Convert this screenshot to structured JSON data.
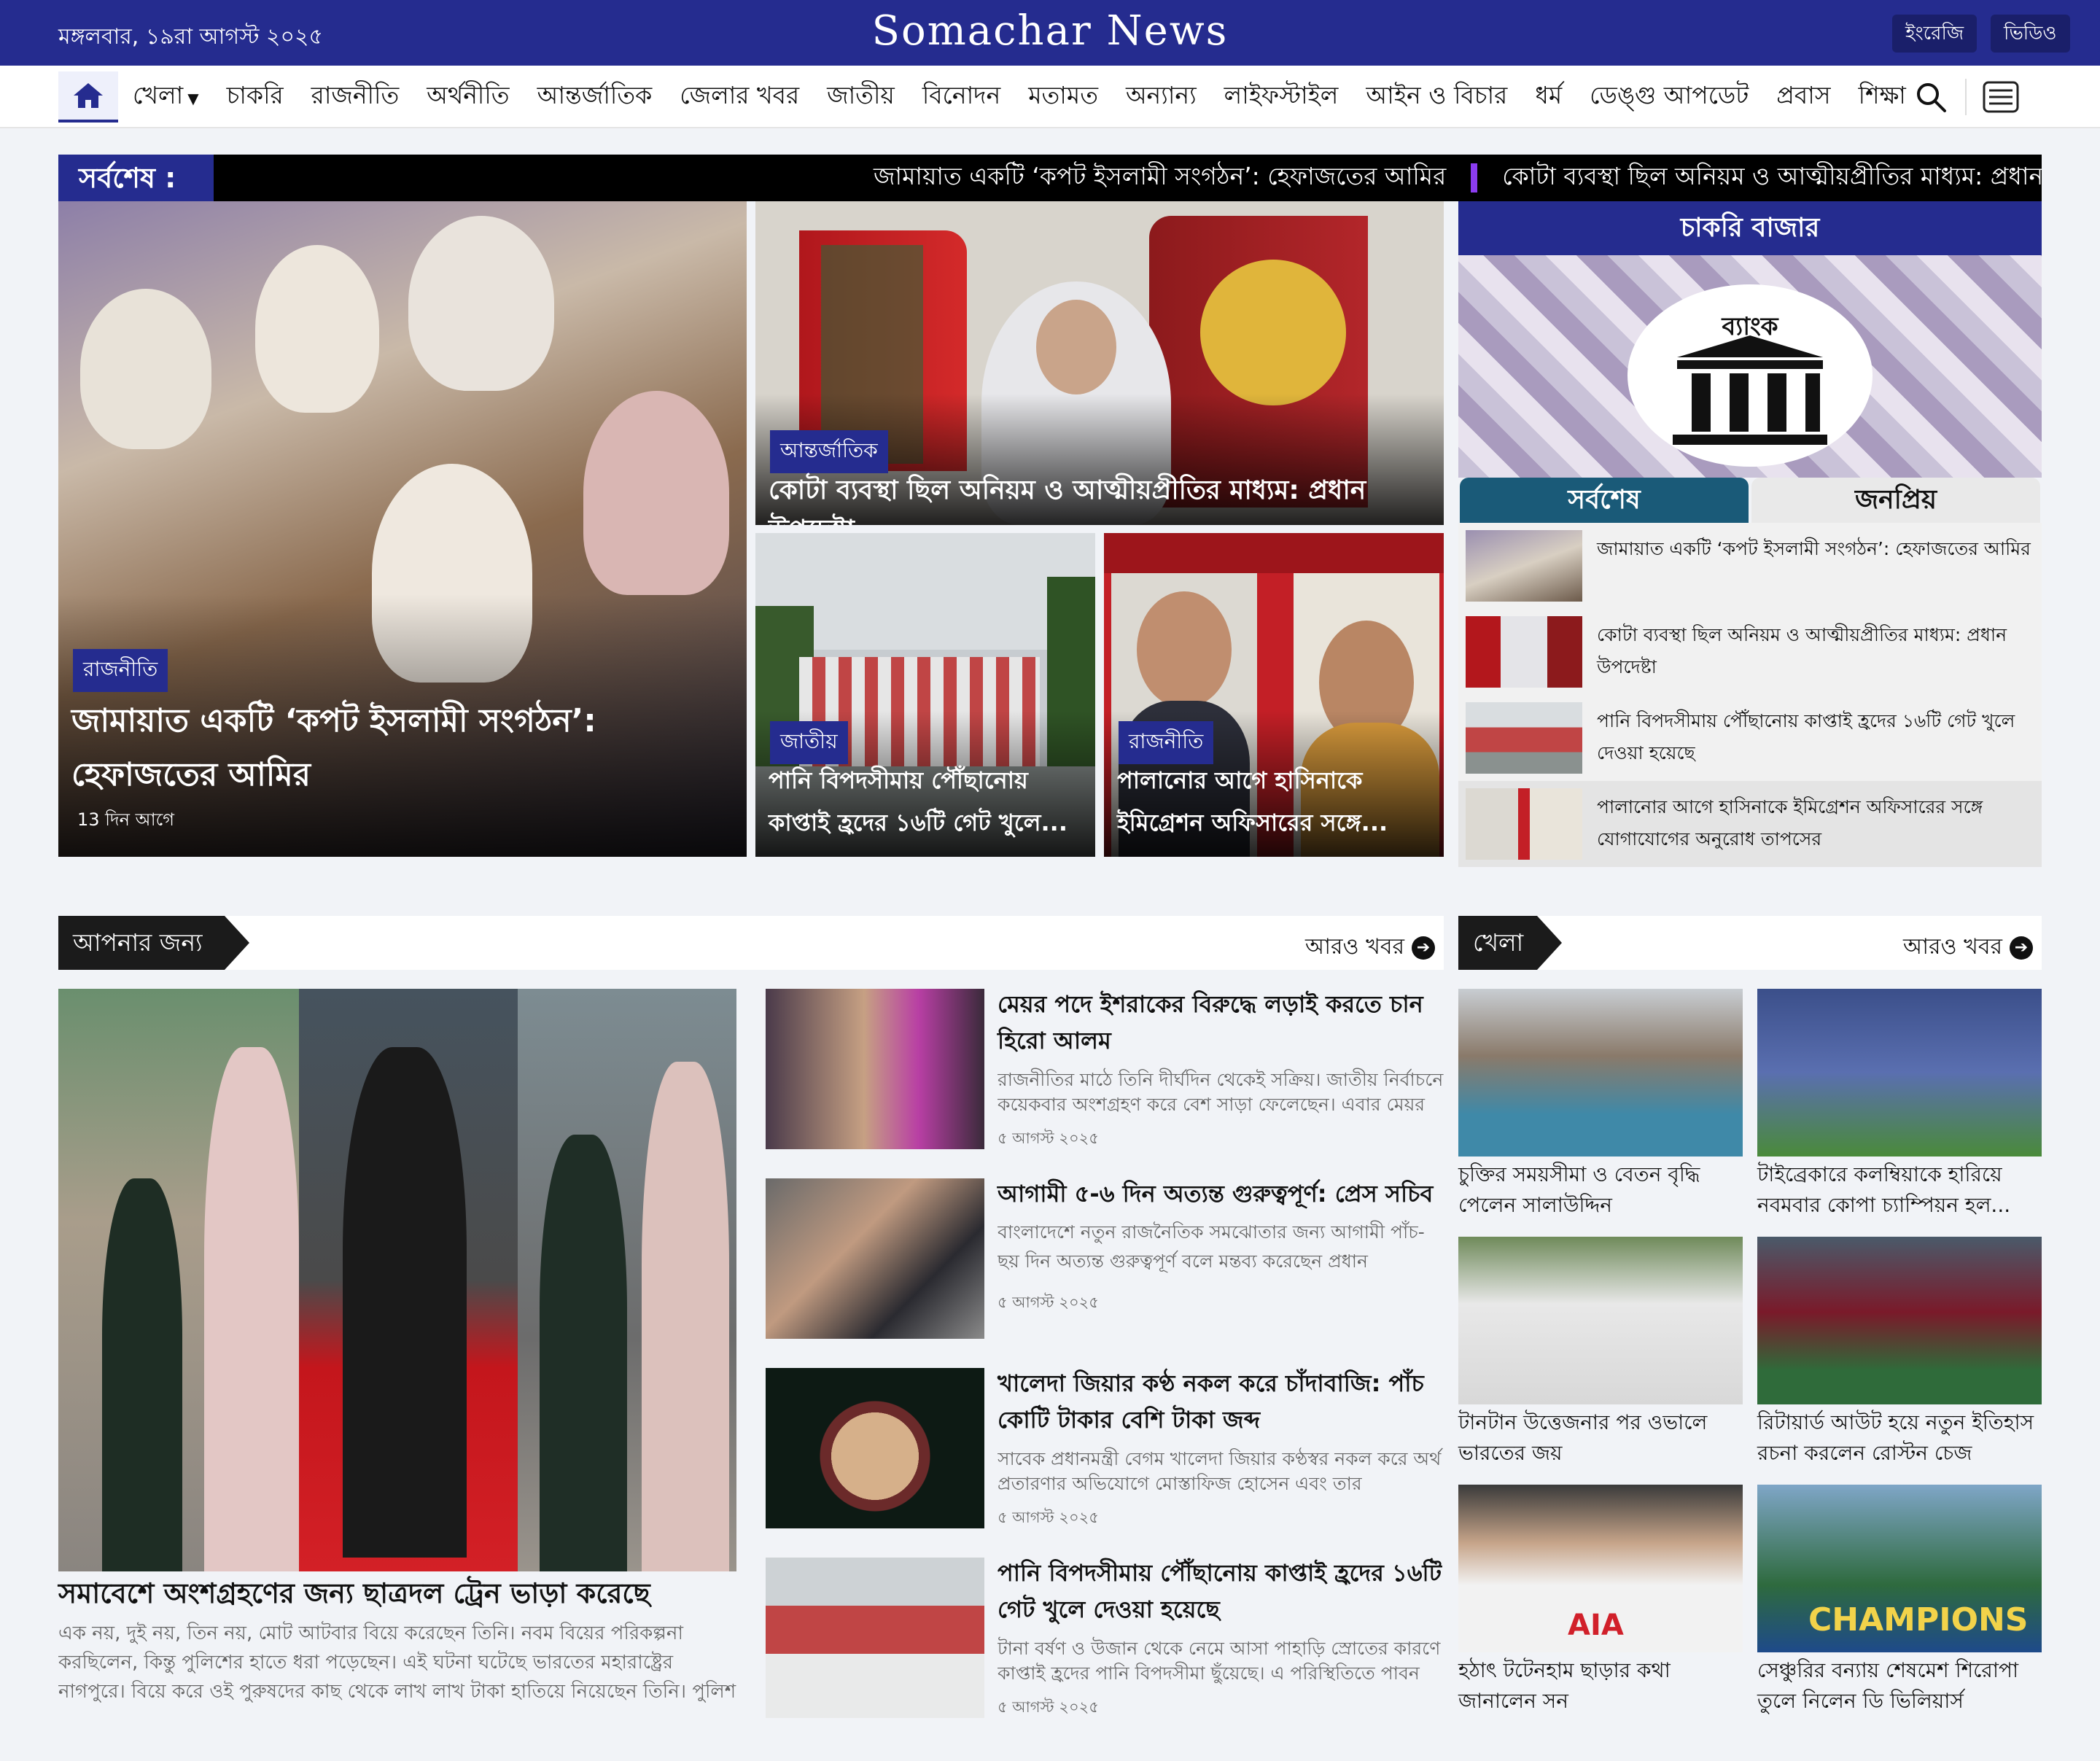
{
  "header": {
    "date": "মঙ্গলবার, ১৯রা আগস্ট ২০২৫",
    "brand": "Somachar News",
    "btn_english": "ইংরেজি",
    "btn_video": "ভিডিও"
  },
  "nav": {
    "items": [
      "খেলা",
      "চাকরি",
      "রাজনীতি",
      "অর্থনীতি",
      "আন্তর্জাতিক",
      "জেলার খবর",
      "জাতীয়",
      "বিনোদন",
      "মতামত",
      "অন্যান্য",
      "লাইফস্টাইল",
      "আইন ও বিচার",
      "ধর্ম",
      "ডেঙ্গু আপডেট",
      "প্রবাস",
      "শিক্ষা"
    ]
  },
  "ticker": {
    "label": "সর্বশেষ :",
    "items": [
      "জামায়াত একটি ‘কপট ইসলামী সংগঠন’: হেফাজতের আমির",
      "কোটা ব্যবস্থা ছিল অনিয়ম ও আত্মীয়প্রীতির মাধ্যম: প্রধান উপদেষ্টা"
    ]
  },
  "hero": {
    "main": {
      "category": "রাজনীতি",
      "title": "জামায়াত একটি ‘কপট ইসলামী সংগঠন’: হেফাজতের আমির",
      "time": "13 দিন আগে"
    },
    "top_right": {
      "category": "আন্তর্জাতিক",
      "title": "কোটা ব্যবস্থা ছিল অনিয়ম ও আত্মীয়প্রীতির মাধ্যম: প্রধান উপদেষ্টা"
    },
    "bottom_left": {
      "category": "জাতীয়",
      "title": "পানি বিপদসীমায় পৌঁছানোয় কাপ্তাই হ্রদের ১৬টি গেট খুলে..."
    },
    "bottom_right": {
      "category": "রাজনীতি",
      "title": "পালানোর আগে হাসিনাকে ইমিগ্রেশন অফিসারের সঙ্গে..."
    }
  },
  "sidebar": {
    "job_title": "চাকরি বাজার",
    "bank_label": "ব্যাংক",
    "tab_latest": "সর্বশেষ",
    "tab_popular": "জনপ্রিয়",
    "latest": [
      "জামায়াত একটি ‘কপট ইসলামী সংগঠন’: হেফাজতের আমির",
      "কোটা ব্যবস্থা ছিল অনিয়ম ও আত্মীয়প্রীতির মাধ্যম: প্রধান উপদেষ্টা",
      "পানি বিপদসীমায় পৌঁছানোয় কাপ্তাই হ্রদের ১৬টি গেট খুলে দেওয়া হয়েছে",
      "পালানোর আগে হাসিনাকে ইমিগ্রেশন অফিসারের সঙ্গে যোগাযোগের অনুরোধ তাপসের"
    ]
  },
  "for_you": {
    "title": "আপনার জন্য",
    "more": "আরও খবর",
    "lead": {
      "title": "সমাবেশে অংশগ্রহণের জন্য ছাত্রদল ট্রেন ভাড়া করেছে",
      "desc": "এক নয়, দুই নয়, তিন নয়, মোট আটবার বিয়ে করেছেন তিনি। নবম বিয়ের পরিকল্পনা করছিলেন, কিন্তু পুলিশের হাতে ধরা পড়েছেন। এই ঘটনা ঘটেছে ভারতের মহারাষ্ট্রের নাগপুরে। বিয়ে করে ওই পুরুষদের কাছ থেকে লাখ লাখ টাকা হাতিয়ে নিয়েছেন তিনি। পুলিশ জানিয়েছে..."
    },
    "stories": [
      {
        "title": "মেয়র পদে ইশরাকের বিরুদ্ধে লড়াই করতে চান হিরো আলম",
        "desc": "রাজনীতির মাঠে তিনি দীর্ঘদিন থেকেই সক্রিয়। জাতীয় নির্বাচনে কয়েকবার অংশগ্রহণ করে বেশ সাড়া ফেলেছেন। এবার মেয়র",
        "date": "৫ আগস্ট ২০২৫"
      },
      {
        "title": "আগামী ৫-৬ দিন অত্যন্ত গুরুত্বপূর্ণ: প্রেস সচিব",
        "desc": "বাংলাদেশে নতুন রাজনৈতিক সমঝোতার জন্য আগামী পাঁচ-ছয় দিন অত্যন্ত গুরুত্বপূর্ণ বলে মন্তব্য করেছেন প্রধান উপদেষ্টার...",
        "date": "৫ আগস্ট ২০২৫"
      },
      {
        "title": "খালেদা জিয়ার কণ্ঠ নকল করে চাঁদাবাজি: পাঁচ কোটি টাকার বেশি টাকা জব্দ",
        "desc": "সাবেক প্রধানমন্ত্রী বেগম খালেদা জিয়ার কণ্ঠস্বর নকল করে অর্থ প্রতারণার অভিযোগে মোস্তাফিজ হোসেন এবং তার",
        "date": "৫ আগস্ট ২০২৫"
      },
      {
        "title": "পানি বিপদসীমায় পৌঁছানোয় কাপ্তাই হ্রদের ১৬টি গেট খুলে দেওয়া হয়েছে",
        "desc": "টানা বর্ষণ ও উজান থেকে নেমে আসা পাহাড়ি স্রোতের কারণে কাপ্তাই হ্রদের পানি বিপদসীমা ছুঁয়েছে। এ পরিস্থিতিতে পাবন",
        "date": "৫ আগস্ট ২০২৫"
      }
    ]
  },
  "sports": {
    "title": "খেলা",
    "more": "আরও খবর",
    "items": [
      "চুক্তির সময়সীমা ও বেতন বৃদ্ধি পেলেন সালাউদ্দিন",
      "টাইব্রেকারে কলম্বিয়াকে হারিয়ে নবমবার কোপা চ্যাম্পিয়ন হল...",
      "টানটান উত্তেজনার পর ওভালে ভারতের জয়",
      "রিটায়ার্ড আউট হয়ে নতুন ইতিহাস রচনা করলেন রোস্টন চেজ",
      "হঠাৎ টটেনহাম ছাড়ার কথা জানালেন সন",
      "সেঞ্চুরির বন্যায় শেষমেশ শিরোপা তুলে নিলেন ডি ভিলিয়ার্স"
    ],
    "img_text": [
      "AIA",
      "CHAMPIONS"
    ]
  },
  "colors": {
    "brand": "#252c8f",
    "ticker_bg": "#000000",
    "tab_active": "#1a5a78",
    "ticker_sep": "#8b3cf0"
  }
}
